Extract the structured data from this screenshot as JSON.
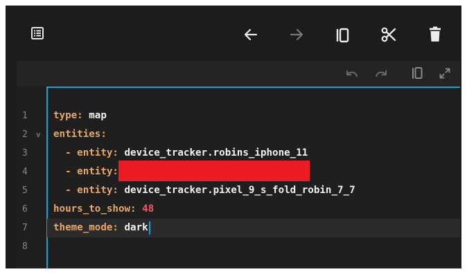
{
  "toolbar": {
    "icons": [
      "list-icon",
      "arrow-left-icon",
      "arrow-right-icon",
      "copy-icon",
      "cut-icon",
      "delete-icon"
    ]
  },
  "editor_header": {
    "icons": [
      "undo-icon",
      "redo-icon",
      "copy-icon",
      "expand-icon"
    ]
  },
  "editor": {
    "line_numbers": [
      "1",
      "2",
      "3",
      "4",
      "5",
      "6",
      "7",
      "8"
    ],
    "fold_marker": "v",
    "lines": [
      {
        "key": "type",
        "sep": ": ",
        "value": "map"
      },
      {
        "key": "entities",
        "sep": ":"
      },
      {
        "dash": "  - ",
        "key": "entity",
        "sep": ": ",
        "value": "device_tracker.robins_iphone_11"
      },
      {
        "dash": "  - ",
        "key": "entity",
        "sep": ":",
        "redacted": true
      },
      {
        "dash": "  - ",
        "key": "entity",
        "sep": ": ",
        "value": "device_tracker.pixel_9_s_fold_robin_7_7"
      },
      {
        "key": "hours_to_show",
        "sep": ": ",
        "value": "48"
      },
      {
        "key": "theme_mode",
        "sep": ": ",
        "value": "dark"
      },
      {}
    ],
    "colors": {
      "key": "#e8a766",
      "value": "#f2f2f2",
      "number": "#f1566a",
      "focus": "#13a3d4",
      "redaction": "#ed1c24"
    }
  }
}
